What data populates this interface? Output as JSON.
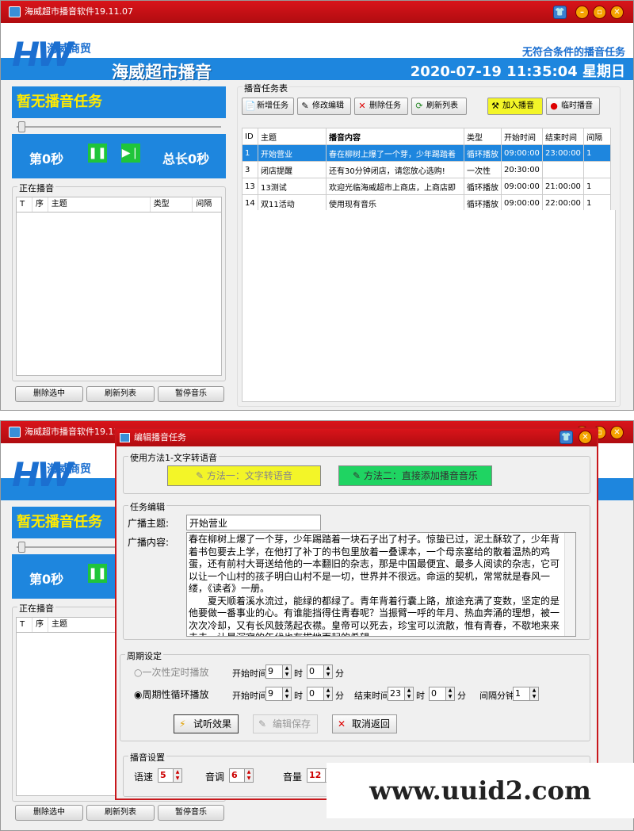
{
  "window": {
    "title": "海威超市播音软件19.11.07"
  },
  "brand": {
    "logo_mark": "HW",
    "logo_company": "海威商贸",
    "app_name": "海威超市播音",
    "notice": "无符合条件的播音任务",
    "datetime": "2020-07-19 11:35:04 星期日"
  },
  "player": {
    "status": "暂无播音任务",
    "current": "第0秒",
    "total": "总长0秒",
    "pause_icon": "pause-icon",
    "next_icon": "skip-next-icon"
  },
  "playing": {
    "group_title": "正在播音",
    "columns": [
      "T",
      "序",
      "主题",
      "类型",
      "间隔"
    ],
    "columns_short": [
      "T",
      "序",
      "主题"
    ]
  },
  "left_buttons": {
    "delete": "删除选中",
    "refresh": "刷新列表",
    "pause": "暂停音乐"
  },
  "tasks": {
    "group_title": "播音任务表",
    "toolbar": {
      "add": "新增任务",
      "edit": "修改编辑",
      "delete": "删除任务",
      "refresh": "刷新列表",
      "join": "加入播音",
      "instant": "临时播音"
    },
    "columns": [
      "ID",
      "主题",
      "播音内容",
      "类型",
      "开始时间",
      "结束时间",
      "间隔"
    ],
    "rows": [
      {
        "id": "1",
        "topic": "开始营业",
        "content": "春在柳树上爆了一个芽，少年踢踏着",
        "type": "循环播放",
        "start": "09:00:00",
        "end": "23:00:00",
        "interval": "1"
      },
      {
        "id": "3",
        "topic": "闭店提醒",
        "content": "还有30分钟闭店，请您放心选购!",
        "type": "一次性",
        "start": "20:30:00",
        "end": "",
        "interval": ""
      },
      {
        "id": "13",
        "topic": "13测试",
        "content": "欢迎光临海威超市上商店，上商店即",
        "type": "循环播放",
        "start": "09:00:00",
        "end": "21:00:00",
        "interval": "1"
      },
      {
        "id": "14",
        "topic": "双11活动",
        "content": "使用现有音乐",
        "type": "循环播放",
        "start": "09:00:00",
        "end": "22:00:00",
        "interval": "1"
      }
    ]
  },
  "dialog": {
    "title": "编辑播音任务",
    "method_group": "使用方法1-文字转语音",
    "method1": "方法一：文字转语音",
    "method2": "方法二：直接添加播音音乐",
    "edit_group": "任务编辑",
    "topic_label": "广播主题:",
    "topic_value": "开始营业",
    "content_label": "广播内容:",
    "content_value": "春在柳树上爆了一个芽，少年踢踏着一块石子出了村子。惊蛰已过，泥土酥软了，少年背着书包要去上学，在他打了补丁的书包里放着一叠课本，一个母亲塞给的散着温热的鸡蛋，还有前村大哥送给他的一本翻旧的杂志，那是中国最便宜、最多人阅读的杂志，它可以让一个山村的孩子明白山村不是一切，世界并不很远。命运的契机，常常就是春风一缕，《读者》一册。\n　　夏天顺着溪水流过，能绿的都绿了。青年背着行囊上路，旅途充满了变数，坚定的是他要做一番事业的心。有谁能挡得住青春呢？当振臂一呼的年月、热血奔涌的理想，被一次次冷却，又有长风鼓荡起衣襟。皇帝可以死去，珍宝可以流散，惟有青春，不歇地来来去去，让最沉寂的年代也有拔地而起的希望",
    "cycle_group": "周期设定",
    "once_label": "一次性定时播放",
    "cycle_label": "周期性循环播放",
    "start_label": "开始时间",
    "hour_label": "时",
    "minute_label": "分",
    "end_label": "结束时间",
    "interval_label": "间隔分钟",
    "once_start_hour": "9",
    "once_start_min": "0",
    "cycle_start_hour": "9",
    "cycle_start_min": "0",
    "cycle_end_hour": "23",
    "cycle_end_min": "0",
    "interval_value": "1",
    "preview": "试听效果",
    "save": "编辑保存",
    "cancel": "取消返回",
    "voice_group": "播音设置",
    "speed_label": "语速",
    "speed_value": "5",
    "pitch_label": "音调",
    "pitch_value": "6",
    "volume_label": "音量",
    "volume_value": "12"
  },
  "watermark": "www.uuid2.com",
  "colors": {
    "title_red": "#c8171c",
    "brand_blue": "#1e86de",
    "status_yellow": "#ffea00",
    "play_green": "#1fc53a",
    "method1_yellow": "#f3f528",
    "method2_green": "#1fd462"
  }
}
